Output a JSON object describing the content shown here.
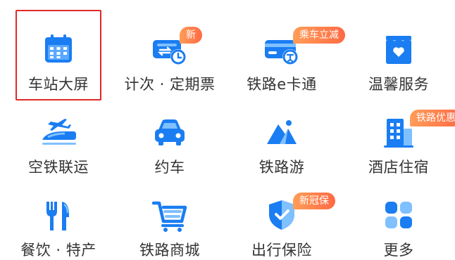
{
  "colors": {
    "primary": "#1a7df2",
    "primary_light": "#7fc0ff",
    "badge": "#ff7a4a",
    "label": "#333333",
    "selection": "#e02828"
  },
  "grid": {
    "rows": [
      [
        {
          "label": "车站大屏",
          "icon": "calendar-icon",
          "badge": "",
          "selected": true
        },
        {
          "label": "计次 · 定期票",
          "icon": "ticket-clock-icon",
          "badge": "新"
        },
        {
          "label": "铁路e卡通",
          "icon": "card-train-icon",
          "badge": "乘车立减"
        },
        {
          "label": "温馨服务",
          "icon": "heart-box-icon",
          "badge": ""
        }
      ],
      [
        {
          "label": "空铁联运",
          "icon": "plane-train-icon",
          "badge": ""
        },
        {
          "label": "约车",
          "icon": "car-icon",
          "badge": ""
        },
        {
          "label": "铁路游",
          "icon": "mountain-icon",
          "badge": ""
        },
        {
          "label": "酒店住宿",
          "icon": "hotel-icon",
          "badge": "铁路优惠"
        }
      ],
      [
        {
          "label": "餐饮 · 特产",
          "icon": "fork-knife-icon",
          "badge": ""
        },
        {
          "label": "铁路商城",
          "icon": "shopping-cart-icon",
          "badge": ""
        },
        {
          "label": "出行保险",
          "icon": "shield-icon",
          "badge": "新冠保"
        },
        {
          "label": "更多",
          "icon": "more-grid-icon",
          "badge": ""
        }
      ]
    ]
  }
}
